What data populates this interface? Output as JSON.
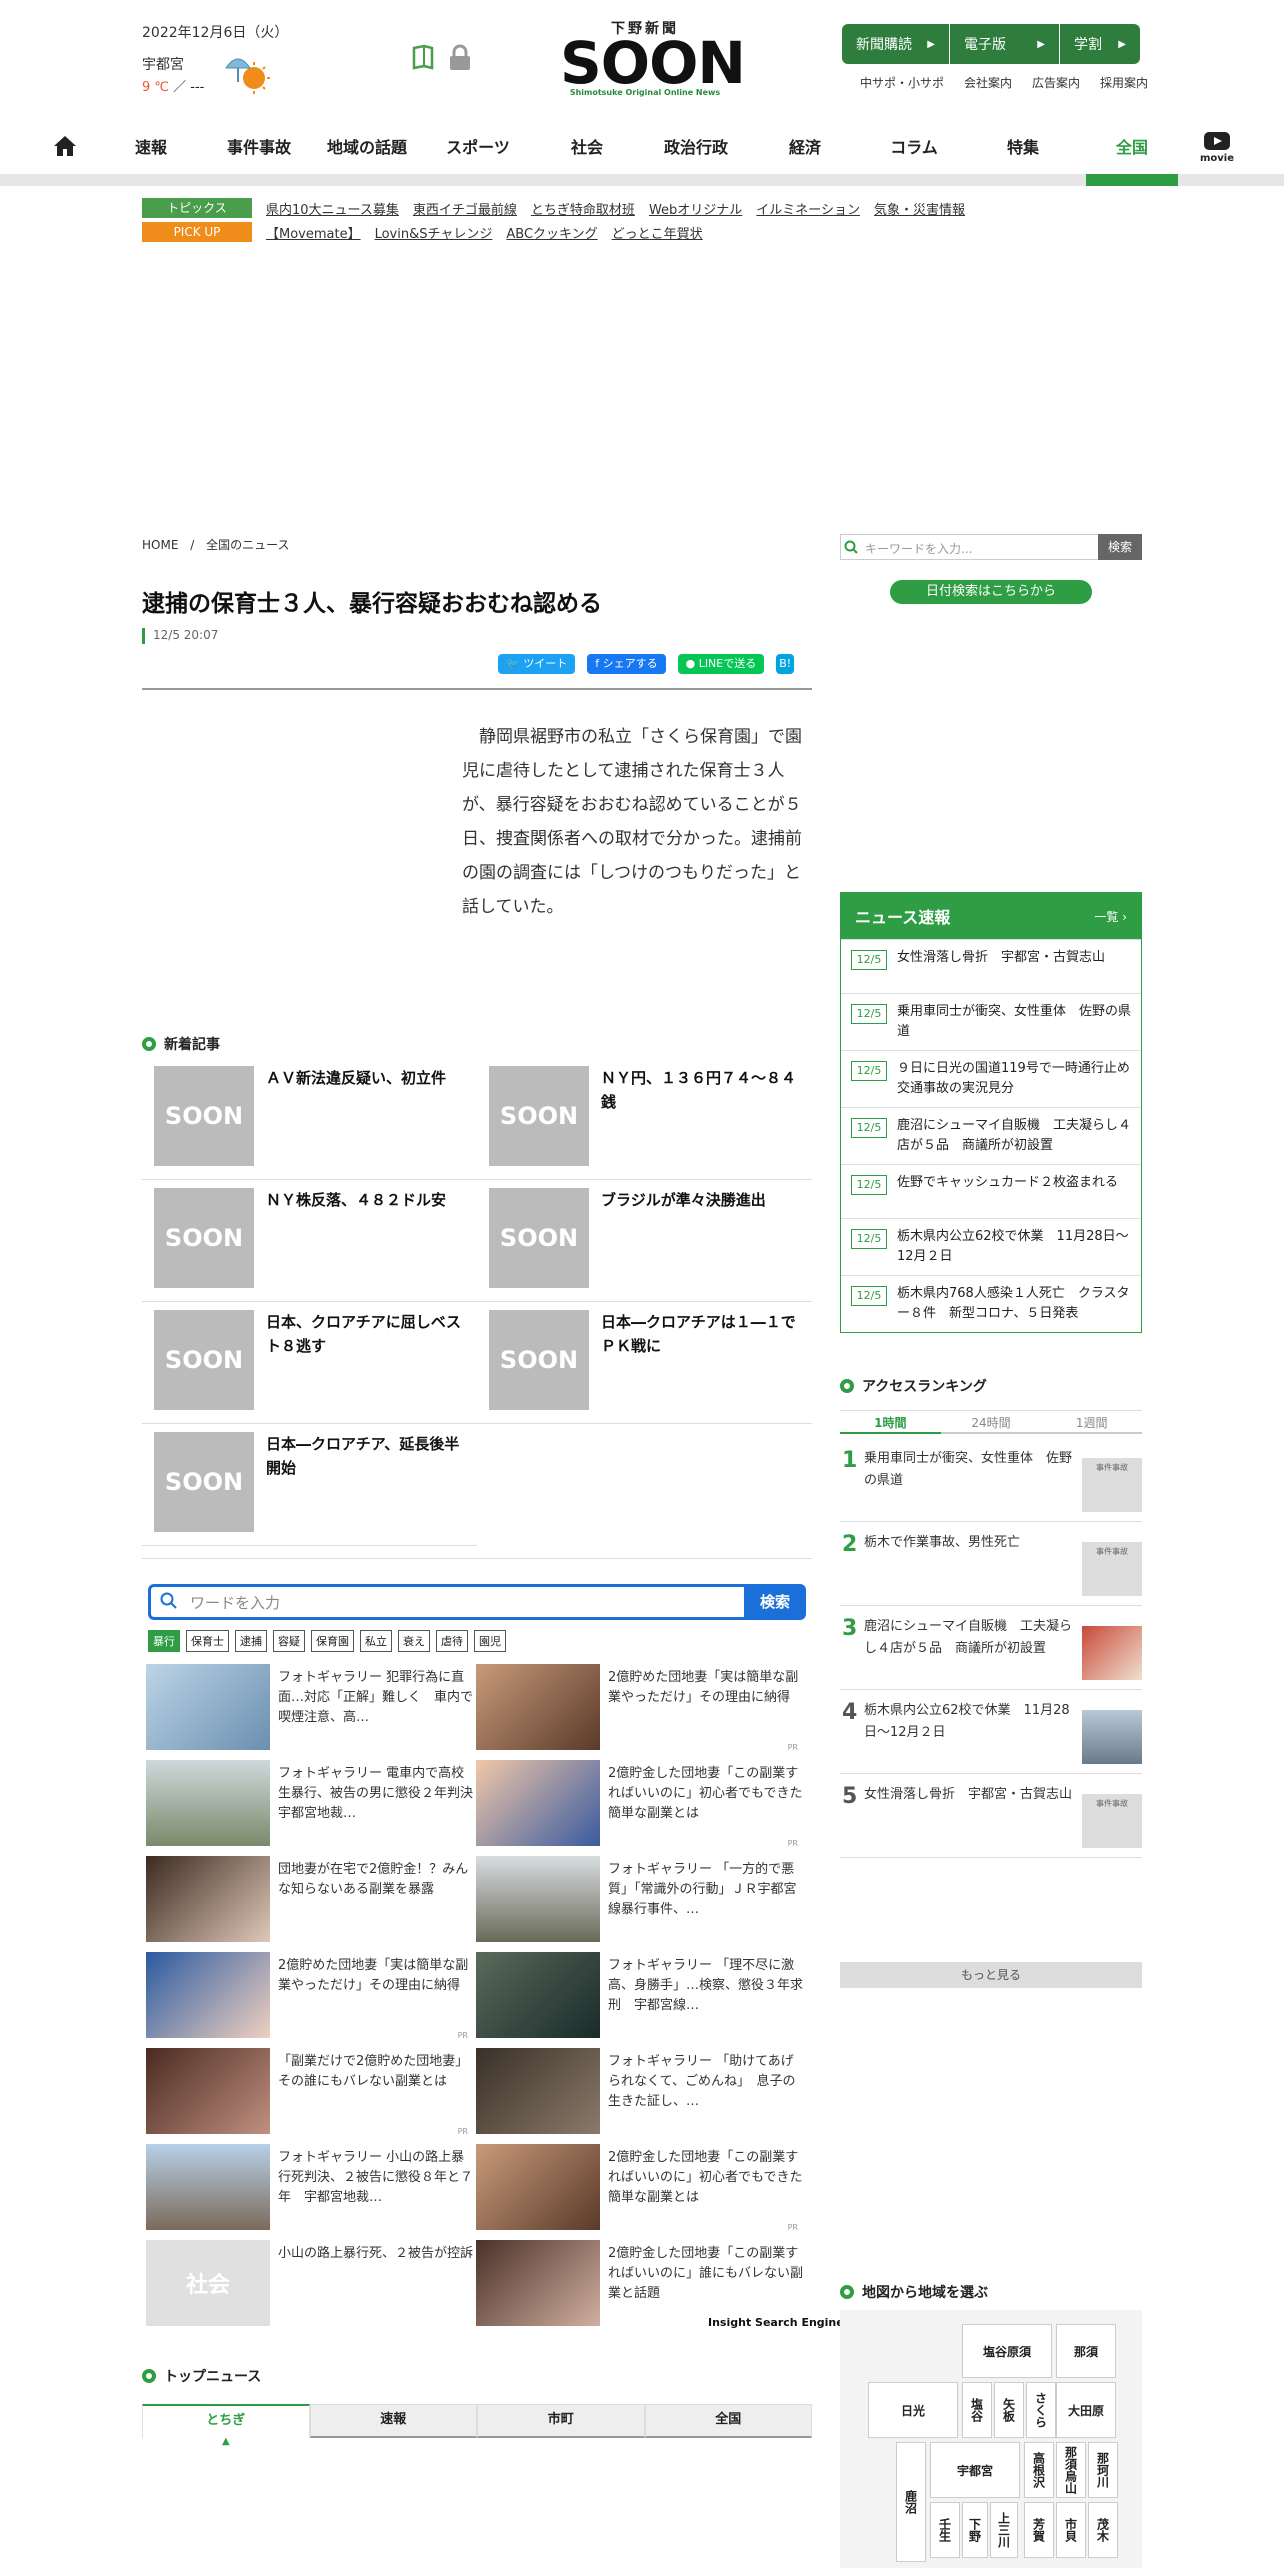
{
  "header": {
    "date": "2022年12月6日（火）",
    "city": "宇都宮",
    "temp_high": "9 ℃",
    "temp_sep": " ／ ---",
    "logo_top": "下野新聞",
    "logo_main": "SOON",
    "logo_sub": "Shimotsuke Original Online News",
    "top_buttons": [
      "新聞購読",
      "電子版",
      "学割"
    ],
    "sub_links": [
      "中サポ・小サポ",
      "会社案内",
      "広告案内",
      "採用案内"
    ]
  },
  "nav": {
    "items": [
      "速報",
      "事件事故",
      "地域の話題",
      "スポーツ",
      "社会",
      "政治行政",
      "経済",
      "コラム",
      "特集",
      "全国"
    ],
    "movie": "movie",
    "accent": "#2e9d44"
  },
  "topics": {
    "label1": "トピックス",
    "items1": [
      "県内10大ニュース募集",
      "東西イチゴ最前線",
      "とちぎ特命取材班",
      "Webオリジナル",
      "イルミネーション",
      "気象・災害情報"
    ],
    "label2": "PICK UP",
    "items2": [
      "【Movemate】",
      "Lovin&Sチャレンジ",
      "ABCクッキング",
      "どっとこ年賀状"
    ]
  },
  "breadcrumb": {
    "home": "HOME",
    "sep": "/",
    "current": "全国のニュース"
  },
  "article": {
    "title": "逮捕の保育士３人、暴行容疑おおむね認める",
    "time": "12/5 20:07",
    "share": [
      "ツイート",
      "シェアする",
      "LINEで送る",
      "B!"
    ],
    "body": "静岡県裾野市の私立「さくら保育園」で園児に虐待したとして逮捕された保育士３人が、暴行容疑をおおむね認めていることが５日、捜査関係者への取材で分かった。逮捕前の園の調査には「しつけのつもりだった」と話していた。"
  },
  "sidebar": {
    "search_placeholder": "キーワードを入力...",
    "search_button": "検索",
    "date_search": "日付検索はこちらから"
  },
  "flash": {
    "title": "ニュース速報",
    "more": "一覧 ›",
    "items": [
      {
        "date": "12/5",
        "text": "女性滑落し骨折　宇都宮・古賀志山"
      },
      {
        "date": "12/5",
        "text": "乗用車同士が衝突、女性重体　佐野の県道"
      },
      {
        "date": "12/5",
        "text": "９日に日光の国道119号で一時通行止め　交通事故の実況見分"
      },
      {
        "date": "12/5",
        "text": "鹿沼にシューマイ自販機　工夫凝らし４店が５品　商議所が初設置"
      },
      {
        "date": "12/5",
        "text": "佐野でキャッシュカード２枚盗まれる"
      },
      {
        "date": "12/5",
        "text": "栃木県内公立62校で休業　11月28日〜12月２日"
      },
      {
        "date": "12/5",
        "text": "栃木県内768人感染１人死亡　クラスター８件　新型コロナ、５日発表"
      }
    ]
  },
  "new_articles": {
    "title": "新着記事",
    "thumb": "SOON",
    "items": [
      "ＡＶ新法違反疑い、初立件",
      "ＮＹ円、１３６円７４〜８４銭",
      "ＮＹ株反落、４８２ドル安",
      "ブラジルが準々決勝進出",
      "日本、クロアチアに屈しベスト８逃す",
      "日本―クロアチアは１―１でＰＫ戦に",
      "日本―クロアチア、延長後半開始"
    ]
  },
  "ise": {
    "placeholder": "ワードを入力",
    "button": "検索",
    "keywords": [
      "暴行",
      "保育士",
      "逮捕",
      "容疑",
      "保育園",
      "私立",
      "衰え",
      "虐待",
      "園児"
    ],
    "logo": "Insight Search Engine",
    "ads": [
      "フォトギャラリー 犯罪行為に直面…対応「正解」難しく　車内で喫煙注意、高…",
      "2億貯めた団地妻「実は簡単な副業やっただけ」その理由に納得",
      "フォトギャラリー 電車内で高校生暴行、被告の男に懲役２年判決　宇都宮地裁…",
      "2億貯金した団地妻「この副業すればいいのに」初心者でもできた簡単な副業とは",
      "団地妻が在宅で2億貯金！？みんな知らないある副業を暴露",
      "フォトギャラリー 「一方的で悪質」「常識外の行動」ＪＲ宇都宮線暴行事件、…",
      "2億貯めた団地妻「実は簡単な副業やっただけ」その理由に納得",
      "フォトギャラリー 「理不尽に激高、身勝手」…検察、懲役３年求刑　宇都宮線…",
      "「副業だけで2億貯めた団地妻」その誰にもバレない副業とは",
      "フォトギャラリー 「助けてあげられなくて、ごめんね」　息子の生きた証し、…",
      "フォトギャラリー 小山の路上暴行死判決、２被告に懲役８年と７年　宇都宮地裁…",
      "2億貯金した団地妻「この副業すればいいのに」初心者でもできた簡単な副業とは",
      "小山の路上暴行死、２被告が控訴",
      "2億貯金した団地妻「この副業すればいいのに」誰にもバレない副業と話題"
    ],
    "pr": "PR",
    "social_thumb": "社会"
  },
  "top_news": {
    "title": "トップニュース",
    "tabs": [
      "とちぎ",
      "速報",
      "市町",
      "全国"
    ]
  },
  "ranking": {
    "title": "アクセスランキング",
    "tabs": [
      "1時間",
      "24時間",
      "1週間"
    ],
    "items": [
      {
        "rank": "1",
        "text": "乗用車同士が衝突、女性重体　佐野の県道",
        "cat": "事件事故"
      },
      {
        "rank": "2",
        "text": "栃木で作業事故、男性死亡",
        "cat": "事件事故"
      },
      {
        "rank": "3",
        "text": "鹿沼にシューマイ自販機　工夫凝らし４店が５品　商議所が初設置",
        "cat": ""
      },
      {
        "rank": "4",
        "text": "栃木県内公立62校で休業　11月28日〜12月２日",
        "cat": ""
      },
      {
        "rank": "5",
        "text": "女性滑落し骨折　宇都宮・古賀志山",
        "cat": "事件事故"
      }
    ],
    "more": "もっと見る"
  },
  "map": {
    "title": "地図から地域を選ぶ",
    "cells": [
      "塩谷原須",
      "那須",
      "日光",
      "塩谷",
      "矢板",
      "さくら",
      "大田原",
      "宇都宮",
      "高根沢",
      "那須烏山",
      "那珂川",
      "鹿沼",
      "壬生",
      "下野",
      "上三川",
      "芳賀",
      "市貝",
      "茂木"
    ]
  }
}
